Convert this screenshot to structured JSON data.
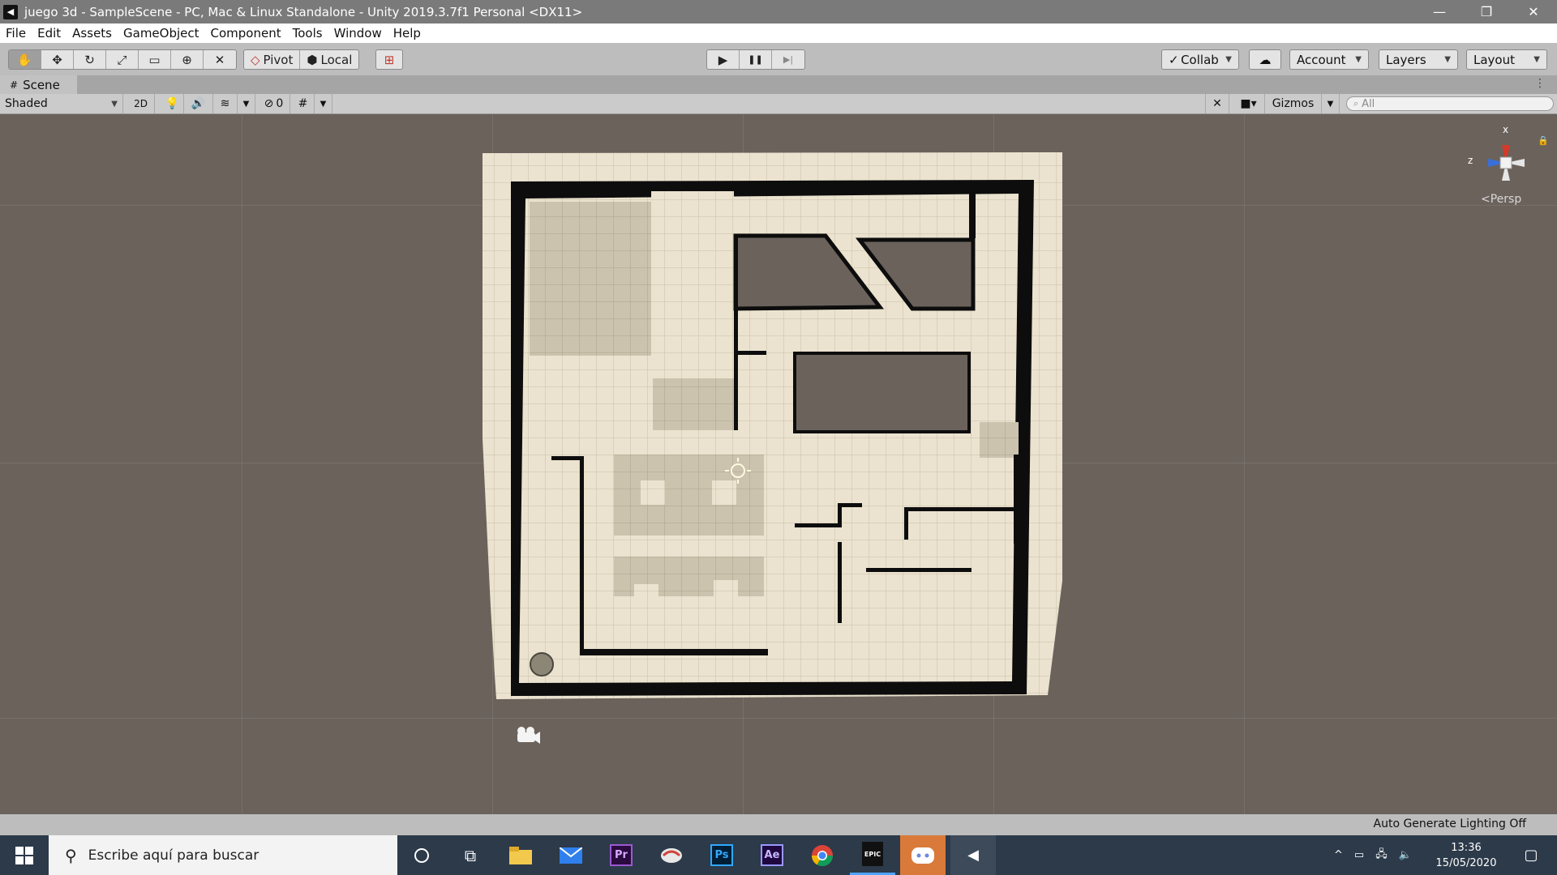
{
  "window": {
    "title": "juego 3d - SampleScene - PC, Mac & Linux Standalone - Unity 2019.3.7f1 Personal <DX11>",
    "minimize": "—",
    "maximize": "❐",
    "close": "✕"
  },
  "menu": [
    "File",
    "Edit",
    "Assets",
    "GameObject",
    "Component",
    "Tools",
    "Window",
    "Help"
  ],
  "toolbar": {
    "tools": [
      {
        "icon": "hand-tool-icon",
        "glyph": "✋",
        "active": true
      },
      {
        "icon": "move-tool-icon",
        "glyph": "✥"
      },
      {
        "icon": "rotate-tool-icon",
        "glyph": "↻"
      },
      {
        "icon": "scale-tool-icon",
        "glyph": "⤢"
      },
      {
        "icon": "rect-tool-icon",
        "glyph": "▭"
      },
      {
        "icon": "transform-tool-icon",
        "glyph": "⊕"
      },
      {
        "icon": "custom-tool-icon",
        "glyph": "✕"
      }
    ],
    "pivot_label": "Pivot",
    "local_label": "Local",
    "play_glyph": "▶",
    "pause_glyph": "❚❚",
    "step_glyph": "▶|",
    "collab_label": "Collab",
    "account_label": "Account",
    "layers_label": "Layers",
    "layout_label": "Layout"
  },
  "scene_tab": {
    "label": "Scene"
  },
  "scene_toolbar": {
    "draw_mode": "Shaded",
    "mode_2d": "2D",
    "hidden_count": "0",
    "gizmos_label": "Gizmos",
    "search_placeholder": "All"
  },
  "viewport": {
    "gizmo_x": "x",
    "gizmo_z": "z",
    "projection": "<Persp"
  },
  "status": {
    "lighting": "Auto Generate Lighting Off"
  },
  "taskbar": {
    "search_placeholder": "Escribe aquí para buscar",
    "apps": [
      "cortana",
      "task-view",
      "file-explorer",
      "mail",
      "premiere",
      "app-2",
      "photoshop",
      "after-effects",
      "chrome",
      "epic-games",
      "discord",
      "unity"
    ],
    "premiere_label": "Pr",
    "photoshop_label": "Ps",
    "after_effects_label": "Ae",
    "epic_label": "EPIC",
    "time": "13:36",
    "date": "15/05/2020"
  },
  "colors": {
    "floor": "#e8e0cc",
    "wall_shadow": "#0d0d0d",
    "background": "#6b625c"
  }
}
